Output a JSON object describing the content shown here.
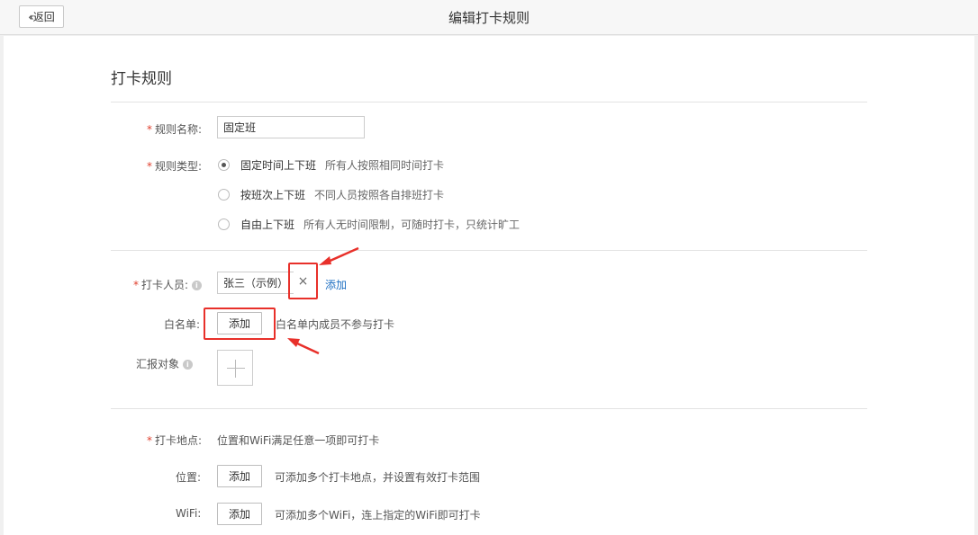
{
  "header": {
    "back_label": "返回",
    "title": "编辑打卡规则"
  },
  "section": {
    "title": "打卡规则"
  },
  "rule_name": {
    "label": "规则名称:",
    "value": "固定班"
  },
  "rule_type": {
    "label": "规则类型:",
    "options": [
      {
        "label": "固定时间上下班",
        "desc": "所有人按照相同时间打卡",
        "selected": true
      },
      {
        "label": "按班次上下班",
        "desc": "不同人员按照各自排班打卡",
        "selected": false
      },
      {
        "label": "自由上下班",
        "desc": "所有人无时间限制，可随时打卡，只统计旷工",
        "selected": false
      }
    ]
  },
  "members": {
    "label": "打卡人员:",
    "tag": "张三（示例）",
    "remove_glyph": "×",
    "add_link": "添加"
  },
  "whitelist": {
    "label": "白名单:",
    "add_button": "添加",
    "hint": "白名单内成员不参与打卡"
  },
  "report_to": {
    "label": "汇报对象"
  },
  "location": {
    "label": "打卡地点:",
    "hint": "位置和WiFi满足任意一项即可打卡"
  },
  "position": {
    "label": "位置:",
    "add_button": "添加",
    "hint": "可添加多个打卡地点，并设置有效打卡范围"
  },
  "wifi": {
    "label": "WiFi:",
    "add_button": "添加",
    "hint": "可添加多个WiFi，连上指定的WiFi即可打卡"
  },
  "colors": {
    "required": "#e0402f",
    "link": "#1e6fc2",
    "annotation": "#e8302a"
  }
}
